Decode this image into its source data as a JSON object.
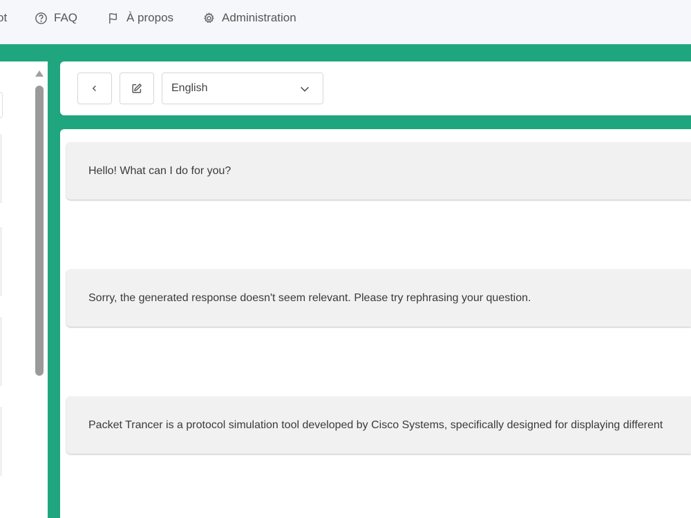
{
  "nav": {
    "cut_label": "ot",
    "faq_label": "FAQ",
    "about_label": "À propos",
    "admin_label": "Administration"
  },
  "toolbar": {
    "back_icon": "chevron-left-icon",
    "edit_icon": "edit-icon",
    "language": {
      "selected": "English",
      "icon": "chevron-down-icon"
    }
  },
  "chat": {
    "messages": [
      {
        "text": "Hello! What can I do for you?"
      },
      {
        "text": "Sorry, the generated response doesn't seem relevant. Please try rephrasing your question."
      },
      {
        "text": "Packet Trancer is a protocol simulation tool developed by Cisco Systems, specifically designed for displaying different"
      }
    ]
  },
  "colors": {
    "accent": "#1fa67e",
    "nav_background": "#f5f7fb",
    "bubble_background": "#f1f1f1"
  }
}
